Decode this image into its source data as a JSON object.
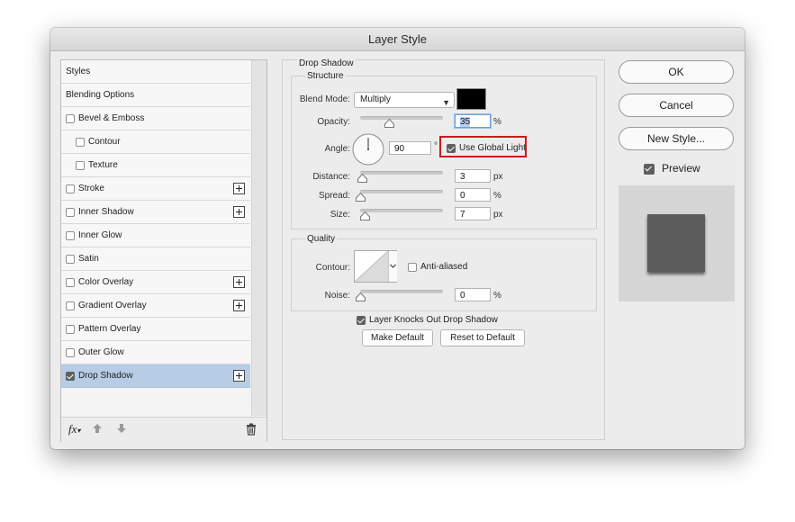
{
  "window": {
    "title": "Layer Style"
  },
  "style_list": {
    "items": [
      {
        "label": "Styles",
        "has_checkbox": false,
        "checked": false,
        "indent": false,
        "has_plus": false,
        "selected": false
      },
      {
        "label": "Blending Options",
        "has_checkbox": false,
        "checked": false,
        "indent": false,
        "has_plus": false,
        "selected": false
      },
      {
        "label": "Bevel & Emboss",
        "has_checkbox": true,
        "checked": false,
        "indent": false,
        "has_plus": false,
        "selected": false
      },
      {
        "label": "Contour",
        "has_checkbox": true,
        "checked": false,
        "indent": true,
        "has_plus": false,
        "selected": false
      },
      {
        "label": "Texture",
        "has_checkbox": true,
        "checked": false,
        "indent": true,
        "has_plus": false,
        "selected": false
      },
      {
        "label": "Stroke",
        "has_checkbox": true,
        "checked": false,
        "indent": false,
        "has_plus": true,
        "selected": false
      },
      {
        "label": "Inner Shadow",
        "has_checkbox": true,
        "checked": false,
        "indent": false,
        "has_plus": true,
        "selected": false
      },
      {
        "label": "Inner Glow",
        "has_checkbox": true,
        "checked": false,
        "indent": false,
        "has_plus": false,
        "selected": false
      },
      {
        "label": "Satin",
        "has_checkbox": true,
        "checked": false,
        "indent": false,
        "has_plus": false,
        "selected": false
      },
      {
        "label": "Color Overlay",
        "has_checkbox": true,
        "checked": false,
        "indent": false,
        "has_plus": true,
        "selected": false
      },
      {
        "label": "Gradient Overlay",
        "has_checkbox": true,
        "checked": false,
        "indent": false,
        "has_plus": true,
        "selected": false
      },
      {
        "label": "Pattern Overlay",
        "has_checkbox": true,
        "checked": false,
        "indent": false,
        "has_plus": false,
        "selected": false
      },
      {
        "label": "Outer Glow",
        "has_checkbox": true,
        "checked": false,
        "indent": false,
        "has_plus": false,
        "selected": false
      },
      {
        "label": "Drop Shadow",
        "has_checkbox": true,
        "checked": true,
        "indent": false,
        "has_plus": true,
        "selected": true
      }
    ],
    "footer": {
      "fx_label": "fx"
    }
  },
  "drop_shadow": {
    "section_title": "Drop Shadow",
    "structure": {
      "title": "Structure",
      "blend_mode": {
        "label": "Blend Mode:",
        "value": "Multiply"
      },
      "shadow_color": "#000000",
      "opacity": {
        "label": "Opacity:",
        "value": "35",
        "unit": "%",
        "level": 0.35
      },
      "angle": {
        "label": "Angle:",
        "value": "90",
        "unit": "°",
        "degrees": 90
      },
      "use_global_light": {
        "label": "Use Global Light",
        "checked": true
      },
      "distance": {
        "label": "Distance:",
        "value": "3",
        "unit": "px",
        "level": 0.02
      },
      "spread": {
        "label": "Spread:",
        "value": "0",
        "unit": "%",
        "level": 0.0
      },
      "size": {
        "label": "Size:",
        "value": "7",
        "unit": "px",
        "level": 0.05
      }
    },
    "quality": {
      "title": "Quality",
      "contour": {
        "label": "Contour:"
      },
      "anti_aliased": {
        "label": "Anti-aliased",
        "checked": false
      },
      "noise": {
        "label": "Noise:",
        "value": "0",
        "unit": "%",
        "level": 0.0
      }
    },
    "layer_knocks_out": {
      "label": "Layer Knocks Out Drop Shadow",
      "checked": true
    },
    "make_default_label": "Make Default",
    "reset_default_label": "Reset to Default"
  },
  "actions": {
    "ok_label": "OK",
    "cancel_label": "Cancel",
    "new_style_label": "New Style...",
    "preview": {
      "label": "Preview",
      "checked": true
    }
  },
  "colors": {
    "selection": "#b7cde6",
    "highlight_border": "#cc1a1a",
    "preview_bg": "#d6d6d6",
    "preview_square": "#5c5c5c"
  }
}
